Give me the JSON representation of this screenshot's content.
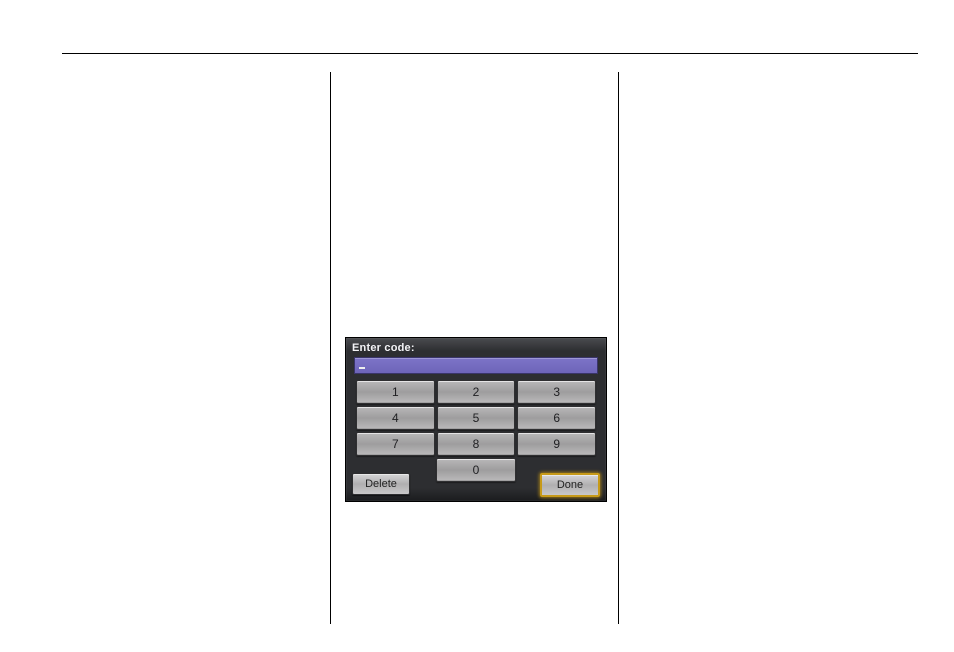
{
  "device": {
    "prompt": "Enter code:",
    "code_value": "",
    "keys": {
      "k1": "1",
      "k2": "2",
      "k3": "3",
      "k4": "4",
      "k5": "5",
      "k6": "6",
      "k7": "7",
      "k8": "8",
      "k9": "9",
      "k0": "0"
    },
    "delete_label": "Delete",
    "done_label": "Done"
  }
}
